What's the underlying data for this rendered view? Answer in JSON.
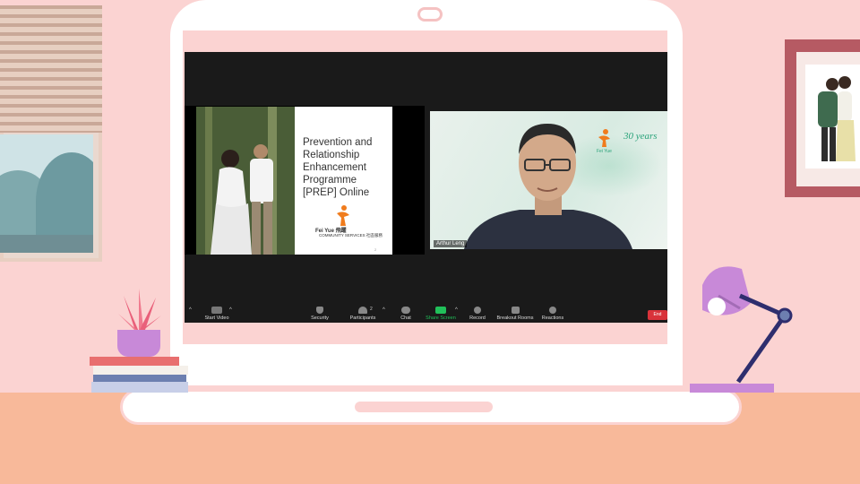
{
  "slide": {
    "title_lines": [
      "Prevention and",
      "Relationship",
      "Enhancement",
      "Programme",
      "[PREP] Online"
    ],
    "logo_text": "Fei Yue 飛躍",
    "logo_sub": "COMMUNITY SERVICES 社區服務",
    "page_number": "2"
  },
  "video": {
    "participant_name": "Arthur Leng",
    "logo_text": "Fei Yue",
    "anniversary_text": "30 years"
  },
  "toolbar": {
    "start_video": "Start Video",
    "security": "Security",
    "participants": "Participants",
    "participants_count": "2",
    "chat": "Chat",
    "share_screen": "Share Screen",
    "record": "Record",
    "breakout_rooms": "Breakout Rooms",
    "reactions": "Reactions",
    "end": "End"
  },
  "colors": {
    "background": "#fbd3d2",
    "desk": "#f8b99a",
    "zoom_bg": "#1a1a1a",
    "share_green": "#21c05a",
    "end_red": "#d9323a",
    "lamp_purple": "#c889d8"
  },
  "icons": [
    "camera-off-icon",
    "shield-icon",
    "participants-icon",
    "chat-icon",
    "share-screen-icon",
    "record-icon",
    "breakout-icon",
    "reactions-icon"
  ]
}
